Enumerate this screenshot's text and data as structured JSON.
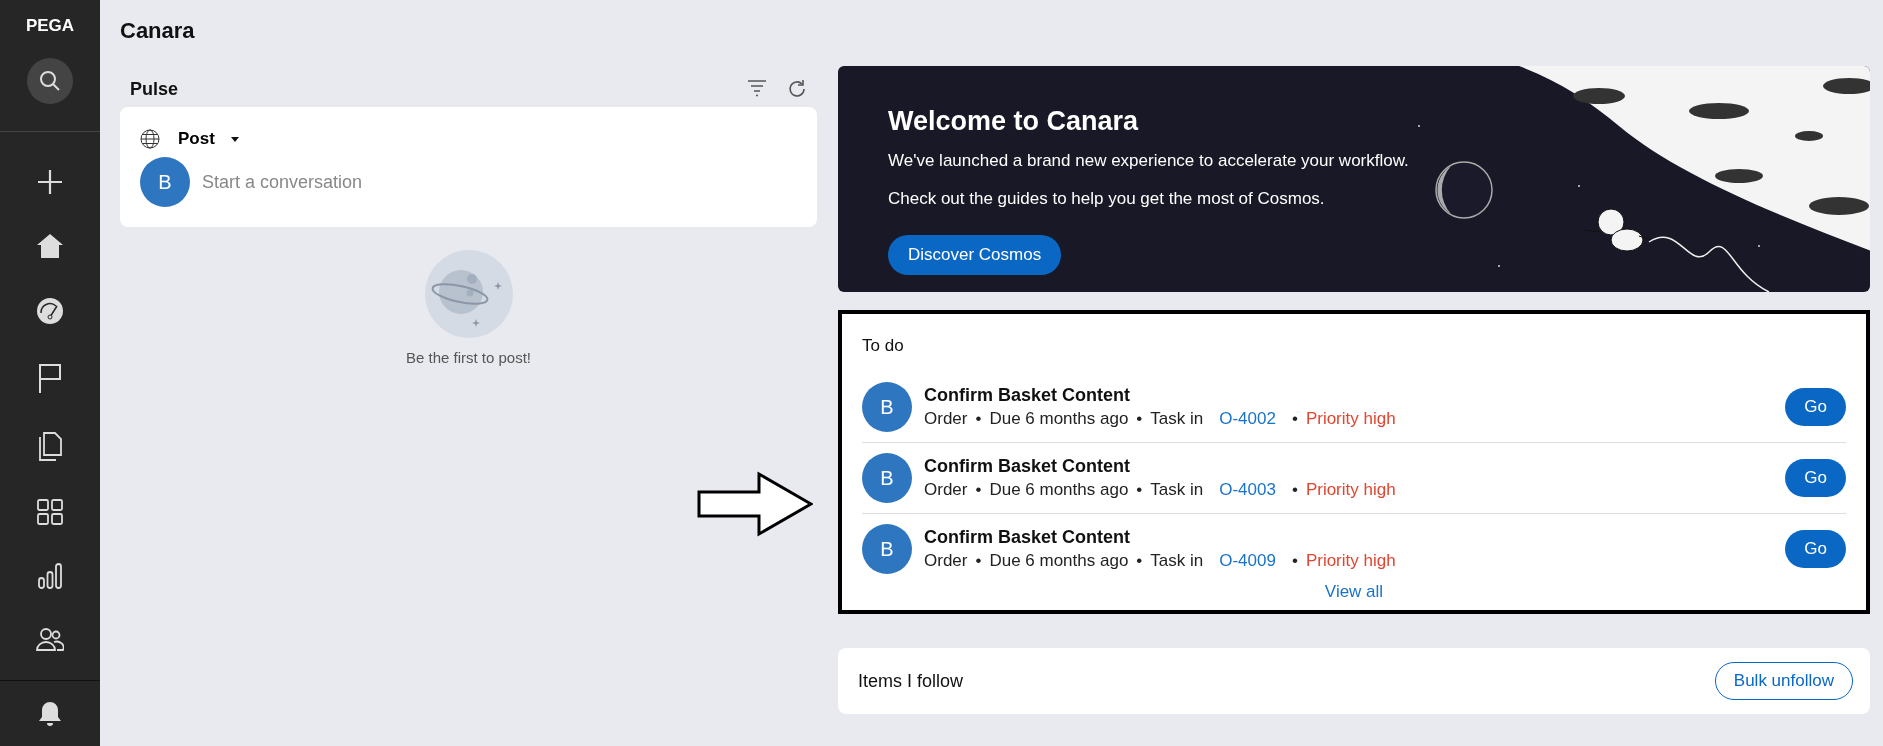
{
  "sidebar": {
    "logo": "PEGA"
  },
  "page": {
    "title": "Canara"
  },
  "pulse": {
    "title": "Pulse",
    "post_menu": "Post",
    "avatar": "B",
    "placeholder": "Start a conversation",
    "empty_text": "Be the first to post!"
  },
  "banner": {
    "title": "Welcome to Canara",
    "lines": [
      "We've launched a brand new experience to accelerate your workflow.",
      "Check out the guides to help you get the most of Cosmos."
    ],
    "button": "Discover Cosmos"
  },
  "todo": {
    "title": "To do",
    "items": [
      {
        "avatar": "B",
        "title": "Confirm Basket Content",
        "meta": [
          {
            "kind": "plain",
            "text": "Order"
          },
          {
            "kind": "bullet",
            "text": "•"
          },
          {
            "kind": "plain",
            "text": "Due 6 months ago"
          },
          {
            "kind": "bullet",
            "text": "•"
          },
          {
            "kind": "plain",
            "text": "Task in"
          },
          {
            "kind": "link",
            "text": "O-4002"
          },
          {
            "kind": "bullet",
            "text": "•"
          },
          {
            "kind": "priority",
            "text": "Priority high"
          }
        ],
        "button": "Go"
      },
      {
        "avatar": "B",
        "title": "Confirm Basket Content",
        "meta": [
          {
            "kind": "plain",
            "text": "Order"
          },
          {
            "kind": "bullet",
            "text": "•"
          },
          {
            "kind": "plain",
            "text": "Due 6 months ago"
          },
          {
            "kind": "bullet",
            "text": "•"
          },
          {
            "kind": "plain",
            "text": "Task in"
          },
          {
            "kind": "link",
            "text": "O-4003"
          },
          {
            "kind": "bullet",
            "text": "•"
          },
          {
            "kind": "priority",
            "text": "Priority high"
          }
        ],
        "button": "Go"
      },
      {
        "avatar": "B",
        "title": "Confirm Basket Content",
        "meta": [
          {
            "kind": "plain",
            "text": "Order"
          },
          {
            "kind": "bullet",
            "text": "•"
          },
          {
            "kind": "plain",
            "text": "Due 6 months ago"
          },
          {
            "kind": "bullet",
            "text": "•"
          },
          {
            "kind": "plain",
            "text": "Task in"
          },
          {
            "kind": "link",
            "text": "O-4009"
          },
          {
            "kind": "bullet",
            "text": "•"
          },
          {
            "kind": "priority",
            "text": "Priority high"
          }
        ],
        "button": "Go"
      }
    ],
    "view_all": "View all"
  },
  "follow": {
    "title": "Items I follow",
    "button": "Bulk unfollow"
  }
}
